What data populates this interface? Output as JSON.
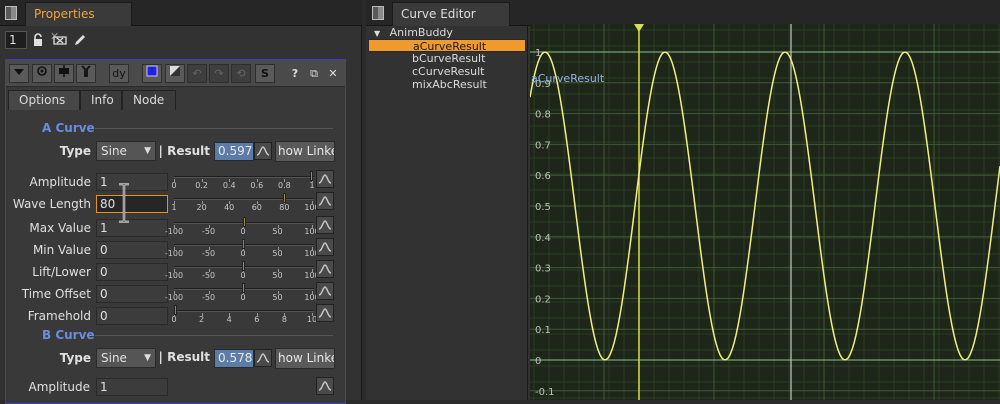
{
  "properties_tab": {
    "label": "Properties",
    "close": "✕"
  },
  "curve_editor_tab": {
    "label": "Curve Editor",
    "close": "✕"
  },
  "toolbar": {
    "count": "1"
  },
  "node_toolbar": {
    "dy_label": "dy",
    "s_label": "S",
    "help_label": "?",
    "float_label": "⧉",
    "close_label": "✕"
  },
  "param_tabs": [
    {
      "label": "Options"
    },
    {
      "label": "Info"
    },
    {
      "label": "Node"
    }
  ],
  "a_curve": {
    "title": "A Curve",
    "type_label": "Type",
    "type_value": "Sine",
    "result_label": "| Result",
    "result_value": "0.5975",
    "link_label": "how Linke",
    "params": [
      {
        "label": "Amplitude",
        "value": "1"
      },
      {
        "label": "Wave Length",
        "value": "80"
      },
      {
        "label": "Max Value",
        "value": "1"
      },
      {
        "label": "Min Value",
        "value": "0"
      },
      {
        "label": "Lift/Lower",
        "value": "0"
      },
      {
        "label": "Time Offset",
        "value": "0"
      },
      {
        "label": "Framehold",
        "value": "0"
      }
    ]
  },
  "b_curve": {
    "title": "B Curve",
    "type_label": "Type",
    "type_value": "Sine",
    "result_label": "| Result",
    "result_value": "0.5782",
    "link_label": "how Linke",
    "params": [
      {
        "label": "Amplitude",
        "value": "1"
      }
    ]
  },
  "slider_labels": {
    "amplitude": [
      "0",
      "0.2",
      "0.4",
      "0.6",
      "0.8",
      "1"
    ],
    "wavelength": [
      "1",
      "20",
      "40",
      "60",
      "80",
      "100"
    ],
    "pm100": [
      "-100",
      "-50",
      "0",
      "50",
      "100"
    ],
    "framehold": [
      "0",
      "2",
      "4",
      "6",
      "8",
      "10"
    ]
  },
  "slider_values": {
    "amplitude": 1,
    "wavelength": 80,
    "max": 1,
    "min": 0,
    "lift": 0,
    "offset": 0,
    "framehold": 0
  },
  "tree": {
    "root": "AnimBuddy",
    "items": [
      {
        "label": "aCurveResult",
        "selected": true
      },
      {
        "label": "bCurveResult",
        "selected": false
      },
      {
        "label": "cCurveResult",
        "selected": false
      },
      {
        "label": "mixAbcResult",
        "selected": false
      }
    ]
  },
  "graph": {
    "curve_label": "aCurveResult",
    "y_ticks": [
      "1",
      "0.9",
      "0.8",
      "0.7",
      "0.6",
      "0.5",
      "0.4",
      "0.3",
      "0.2",
      "0.1",
      "0",
      "-0.1"
    ],
    "colors": {
      "curve": "#f2ef80",
      "playhead": "#d9e04a",
      "axis": "#86c28a",
      "grid": "#3e5a34",
      "selection": "#f0992c"
    }
  }
}
